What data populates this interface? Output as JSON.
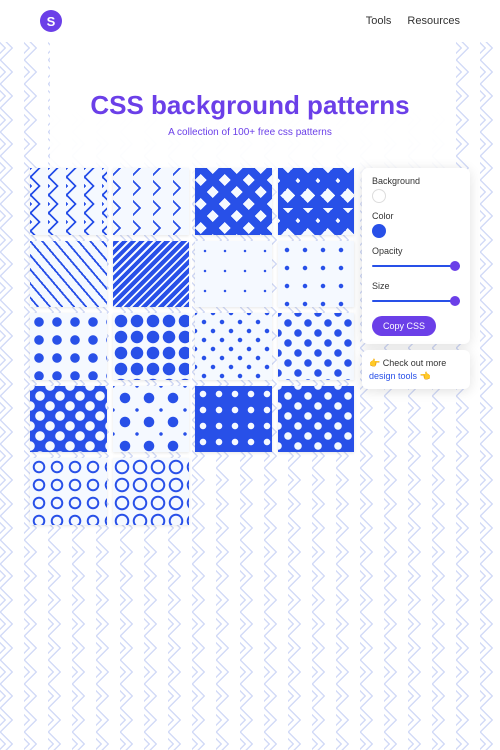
{
  "header": {
    "logo_letter": "S",
    "nav": {
      "tools": "Tools",
      "resources": "Resources"
    }
  },
  "hero": {
    "title": "CSS background patterns",
    "subtitle": "A collection of 100+ free css patterns"
  },
  "controls": {
    "background_label": "Background",
    "color_label": "Color",
    "opacity_label": "Opacity",
    "size_label": "Size",
    "copy_button": "Copy CSS",
    "background_value": "#ffffff",
    "color_value": "#2850e8",
    "opacity_value": 1.0,
    "size_value": 1.0
  },
  "callout": {
    "prefix": "👉 Check out more ",
    "link_text": "design tools",
    "suffix": " 👈"
  },
  "tiles": [
    {
      "name": "zigzag-outline-double"
    },
    {
      "name": "zigzag-outline-single"
    },
    {
      "name": "zigzag-thick"
    },
    {
      "name": "zigzag-vertical-thick"
    },
    {
      "name": "wavy-diagonal"
    },
    {
      "name": "diagonal-lines-blue"
    },
    {
      "name": "dots-tiny"
    },
    {
      "name": "dots-small"
    },
    {
      "name": "dots-medium"
    },
    {
      "name": "dots-large"
    },
    {
      "name": "dots-staggered-small"
    },
    {
      "name": "dots-staggered-medium"
    },
    {
      "name": "dots-inverted-staggered"
    },
    {
      "name": "dots-large-small-alternating"
    },
    {
      "name": "dots-inverted-grid"
    },
    {
      "name": "dots-inverted-staggered-dense"
    },
    {
      "name": "rings-small"
    },
    {
      "name": "rings-medium"
    }
  ]
}
